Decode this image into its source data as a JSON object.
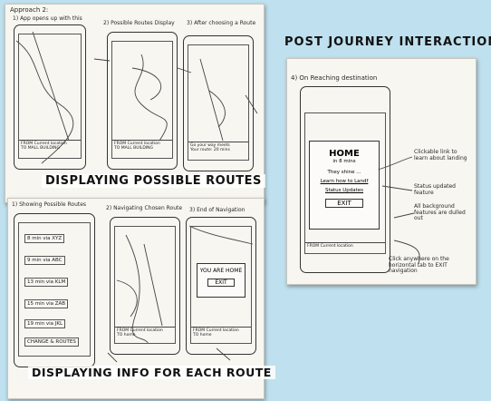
{
  "sheet1": {
    "header": "Approach 2:",
    "panels": [
      {
        "title": "1) App opens up with this",
        "bar_from": "FROM   Current location",
        "bar_to": "TO  MALL BUILDING"
      },
      {
        "title": "2) Possible Routes Display",
        "bar_from": "FROM  Current location",
        "bar_to": "TO  MALL BUILDING"
      },
      {
        "title": "3) After choosing a Route",
        "bar_from": "Go your way meets",
        "bar_to": "Your route: 20 mins"
      }
    ],
    "banner": "DISPLAYING POSSIBLE ROUTES"
  },
  "sheet2": {
    "panels": [
      {
        "title": "1) Showing Possible Routes",
        "routes": [
          "8 min via XYZ",
          "9 min via ABC",
          "13 min via KLM",
          "15 min via ZAB",
          "19 min via JKL",
          "CHANGE & ROUTES"
        ]
      },
      {
        "title": "2) Navigating Chosen Route",
        "bar_from": "FROM  Current location",
        "bar_to": "TO  home"
      },
      {
        "title": "3) End of Navigation",
        "popup": "YOU ARE HOME",
        "exit": "EXIT",
        "bar_from": "FROM  Current location",
        "bar_to": "TO  home"
      }
    ],
    "banner": "DISPLAYING INFO FOR EACH ROUTE"
  },
  "right": {
    "heading": "POST JOURNEY INTERACTIONS",
    "step": "4) On Reaching destination",
    "popup_title": "HOME",
    "popup_sub": "in 8 mins",
    "popup_lines": [
      "They shine ...",
      "Learn how to Landf",
      "Status Updates"
    ],
    "popup_exit": "EXIT",
    "notes": [
      "Clickable link to learn about landing",
      "Status updated feature",
      "All background features are dulled out",
      "Click anywhere on the horizontal tab to EXIT navigation"
    ],
    "bar": "FROM  Current location"
  }
}
